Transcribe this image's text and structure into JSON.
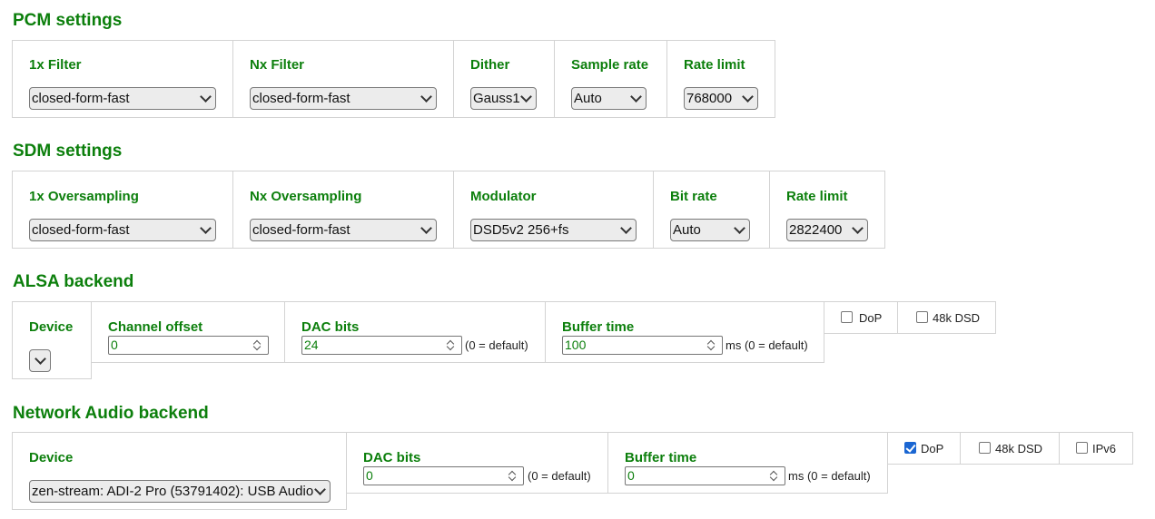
{
  "pcm": {
    "title": "PCM settings",
    "filter1x": {
      "label": "1x Filter",
      "value": "closed-form-fast"
    },
    "filterNx": {
      "label": "Nx Filter",
      "value": "closed-form-fast"
    },
    "dither": {
      "label": "Dither",
      "value": "Gauss1"
    },
    "sample_rate": {
      "label": "Sample rate",
      "value": "Auto"
    },
    "rate_limit": {
      "label": "Rate limit",
      "value": "768000"
    }
  },
  "sdm": {
    "title": "SDM settings",
    "os1x": {
      "label": "1x Oversampling",
      "value": "closed-form-fast"
    },
    "osNx": {
      "label": "Nx Oversampling",
      "value": "closed-form-fast"
    },
    "modulator": {
      "label": "Modulator",
      "value": "DSD5v2 256+fs"
    },
    "bit_rate": {
      "label": "Bit rate",
      "value": "Auto"
    },
    "rate_limit": {
      "label": "Rate limit",
      "value": "2822400"
    }
  },
  "alsa": {
    "title": "ALSA backend",
    "device": {
      "label": "Device",
      "value": ""
    },
    "channel_offset": {
      "label": "Channel offset",
      "value": "0"
    },
    "dac_bits": {
      "label": "DAC bits",
      "value": "24",
      "hint": "(0 = default)"
    },
    "buffer_time": {
      "label": "Buffer time",
      "value": "100",
      "hint": "ms (0 = default)"
    },
    "dop": {
      "label": "DoP",
      "checked": false
    },
    "dsd48k": {
      "label": "48k DSD",
      "checked": false
    }
  },
  "network": {
    "title": "Network Audio backend",
    "device": {
      "label": "Device",
      "value": "zen-stream: ADI-2 Pro (53791402): USB Audio"
    },
    "dac_bits": {
      "label": "DAC bits",
      "value": "0",
      "hint": "(0 = default)"
    },
    "buffer_time": {
      "label": "Buffer time",
      "value": "0",
      "hint": "ms (0 = default)"
    },
    "dop": {
      "label": "DoP",
      "checked": true
    },
    "dsd48k": {
      "label": "48k DSD",
      "checked": false
    },
    "ipv6": {
      "label": "IPv6",
      "checked": false
    }
  },
  "colors": {
    "heading": "#0c7f0c",
    "border": "#d3d3d3",
    "check": "#1a66d2"
  }
}
